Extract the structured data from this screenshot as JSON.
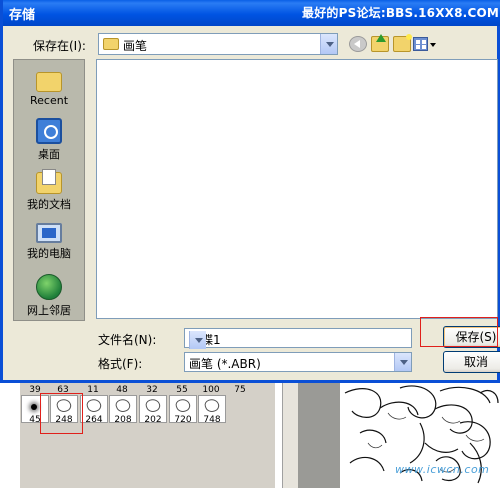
{
  "dialog": {
    "title": "存储",
    "watermark": "最好的PS论坛:BBS.16XX8.COM",
    "save_in_label": "保存在(I):",
    "current_folder": "画笔"
  },
  "places": [
    {
      "label": "Recent",
      "icon": "recent-icon"
    },
    {
      "label": "桌面",
      "icon": "desktop-icon"
    },
    {
      "label": "我的文档",
      "icon": "my-documents-icon"
    },
    {
      "label": "我的电脑",
      "icon": "my-computer-icon"
    },
    {
      "label": "网上邻居",
      "icon": "network-places-icon"
    }
  ],
  "filename": {
    "label": "文件名(N):",
    "value": "蝴蝶1"
  },
  "format": {
    "label": "格式(F):",
    "value": "画笔 (*.ABR)"
  },
  "buttons": {
    "save": "保存(S)",
    "cancel": "取消"
  },
  "brush_panel": {
    "top_sizes": [
      "39",
      "63",
      "11",
      "48",
      "32",
      "55",
      "100",
      "75"
    ],
    "bottom_sizes": [
      "45",
      "248",
      "264",
      "208",
      "202",
      "720",
      "748"
    ]
  },
  "background_watermark": "www.icwcn.com",
  "colors": {
    "titlebar": "#0054e3",
    "dialog_bg": "#ece9d8",
    "highlight_box": "#e0201b"
  }
}
